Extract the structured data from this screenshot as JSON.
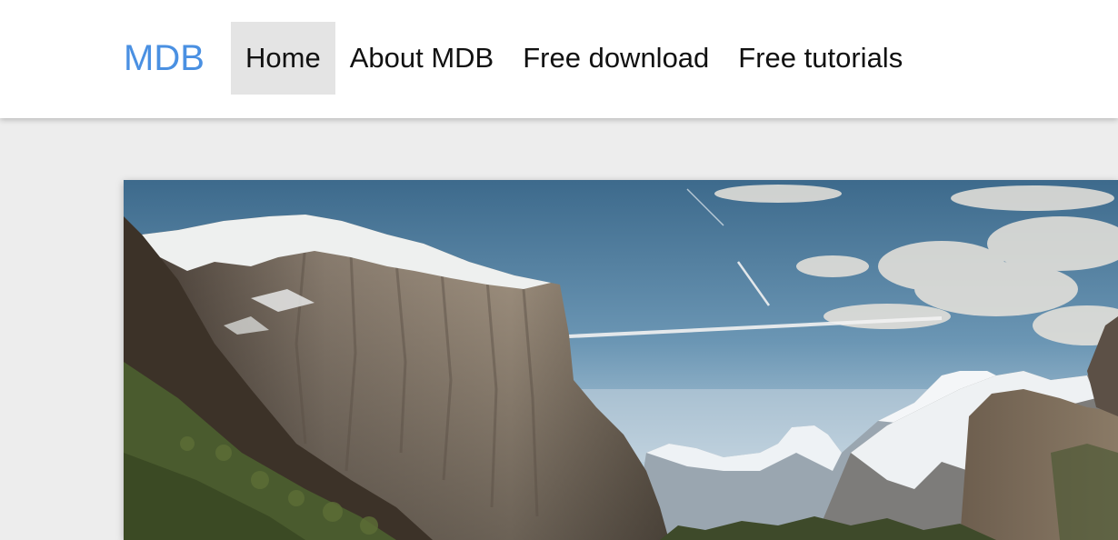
{
  "navbar": {
    "brand": "MDB",
    "items": [
      {
        "label": "Home",
        "active": true
      },
      {
        "label": "About MDB",
        "active": false
      },
      {
        "label": "Free download",
        "active": false
      },
      {
        "label": "Free tutorials",
        "active": false
      }
    ]
  },
  "hero": {
    "image_subject": "mountain valley landscape photo"
  },
  "colors": {
    "brand": "#4a90e2",
    "page_background": "#ededed",
    "active_item_background": "#e4e4e4"
  }
}
